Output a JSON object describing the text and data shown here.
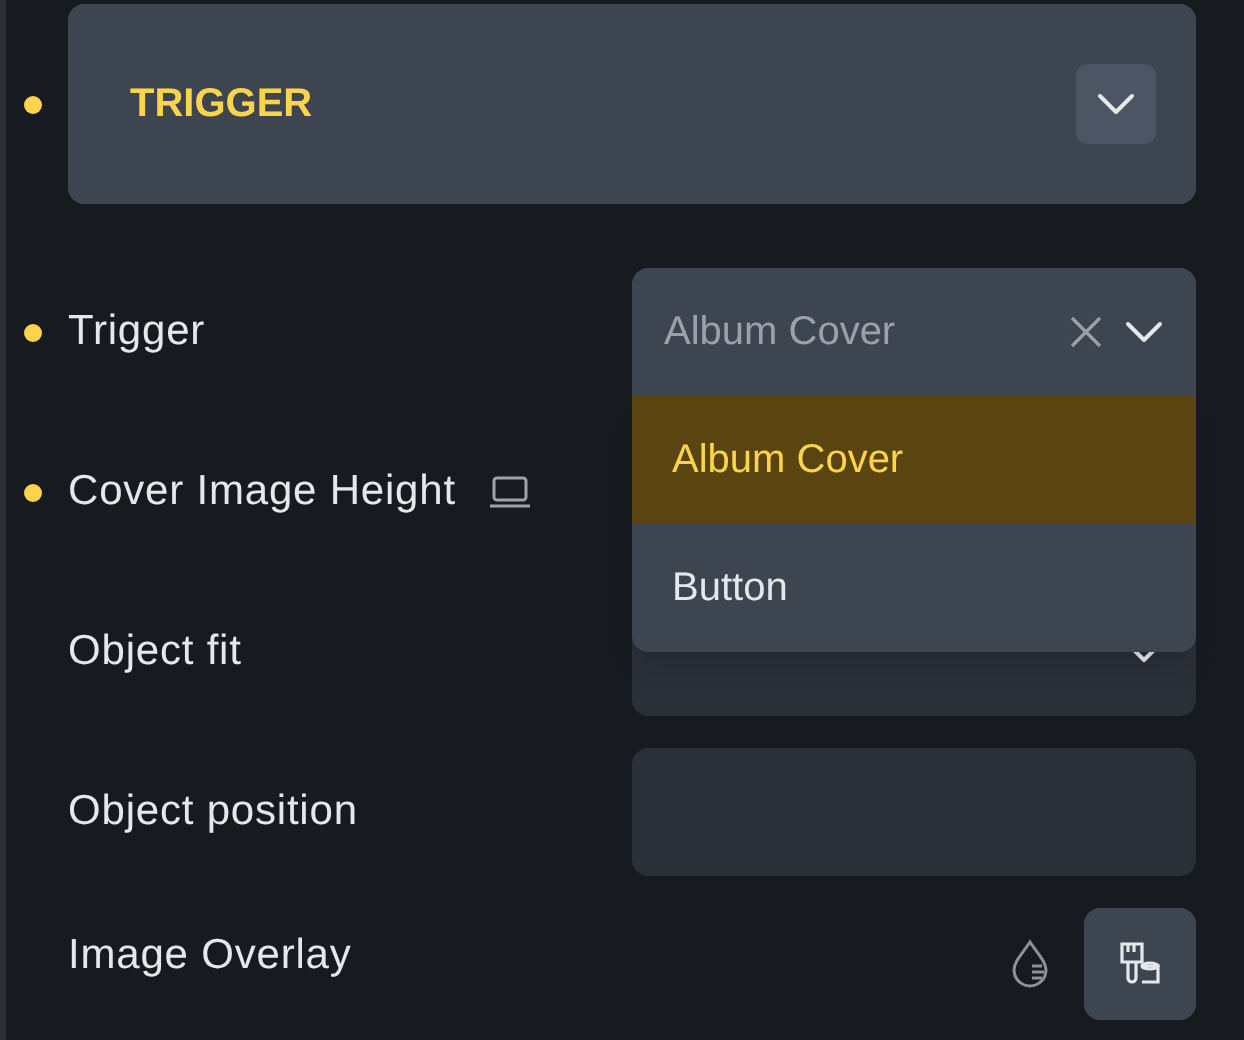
{
  "section": {
    "title": "TRIGGER",
    "modified": true,
    "expanded": false
  },
  "fields": [
    {
      "kind": "select",
      "label": "Trigger",
      "modified": true,
      "value": "Album Cover",
      "open": true,
      "options": [
        {
          "label": "Album Cover",
          "selected": true
        },
        {
          "label": "Button",
          "selected": false
        }
      ]
    },
    {
      "kind": "hidden",
      "label": "Cover Image Height",
      "modified": true,
      "responsive": true
    },
    {
      "kind": "select",
      "label": "Object fit",
      "modified": false,
      "open": false
    },
    {
      "kind": "text",
      "label": "Object position",
      "modified": false
    },
    {
      "kind": "overlay",
      "label": "Image Overlay",
      "modified": false
    }
  ]
}
